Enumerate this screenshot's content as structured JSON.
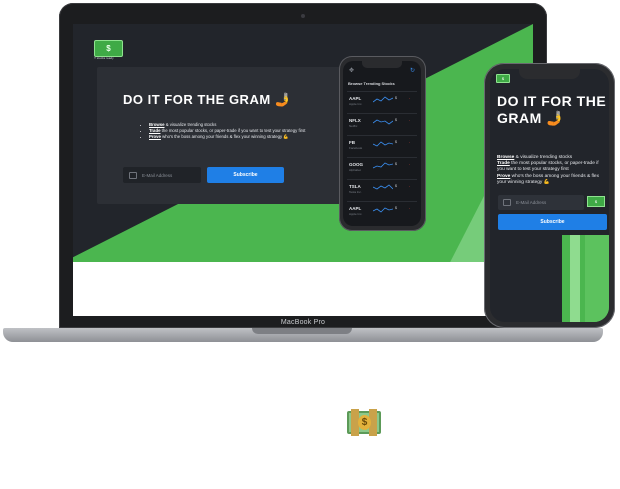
{
  "laptop": {
    "brand": "MacBook Pro",
    "landing": {
      "logo_text": "$",
      "logo_caption": "Y stocks ready",
      "title": "DO IT FOR THE GRAM 🤳",
      "bullets": [
        {
          "strong": "Browse",
          "rest": " & visualize trending stocks"
        },
        {
          "strong": "Trade",
          "rest": " the most popular stocks, or paper-trade if you want to test your strategy first"
        },
        {
          "strong": "Prove",
          "rest": " who's the boss among your friends & flex your winning strategy 💪"
        }
      ],
      "email_placeholder": "E-Mail Address",
      "subscribe_label": "Subscribe"
    },
    "mini_phone": {
      "header": "Browse Trending Stocks",
      "stocks": [
        {
          "ticker": "AAPL",
          "name": "Apple Inc.",
          "price": "$",
          "change": "-"
        },
        {
          "ticker": "NFLX",
          "name": "Netflix",
          "price": "$",
          "change": "-"
        },
        {
          "ticker": "FB",
          "name": "Facebook",
          "price": "$",
          "change": "-"
        },
        {
          "ticker": "GOOG",
          "name": "Alphabet",
          "price": "$",
          "change": "-"
        },
        {
          "ticker": "TSLA",
          "name": "Tesla Inc.",
          "price": "$",
          "change": "-"
        },
        {
          "ticker": "AAPL",
          "name": "Apple Inc.",
          "price": "$",
          "change": "-"
        }
      ]
    }
  },
  "phone": {
    "logo_text": "$",
    "title": "DO IT FOR THE GRAM 🤳",
    "bullets": [
      {
        "strong": "Browse",
        "rest": " & visualize trending stocks"
      },
      {
        "strong": "Trade",
        "rest": " the most popular stocks, or paper-trade if you want to test your strategy first"
      },
      {
        "strong": "Prove",
        "rest": " who's the boss among your friends & flex your winning strategy 💪"
      }
    ],
    "email_placeholder": "E-Mail Address",
    "badge_text": "$",
    "subscribe_label": "Subscribe"
  },
  "footer_icon": {
    "name": "money-bag-icon",
    "glyph": "$"
  },
  "colors": {
    "accent_green": "#4bb64f",
    "button_blue": "#1f7fe6",
    "background_dark": "#22252b"
  }
}
